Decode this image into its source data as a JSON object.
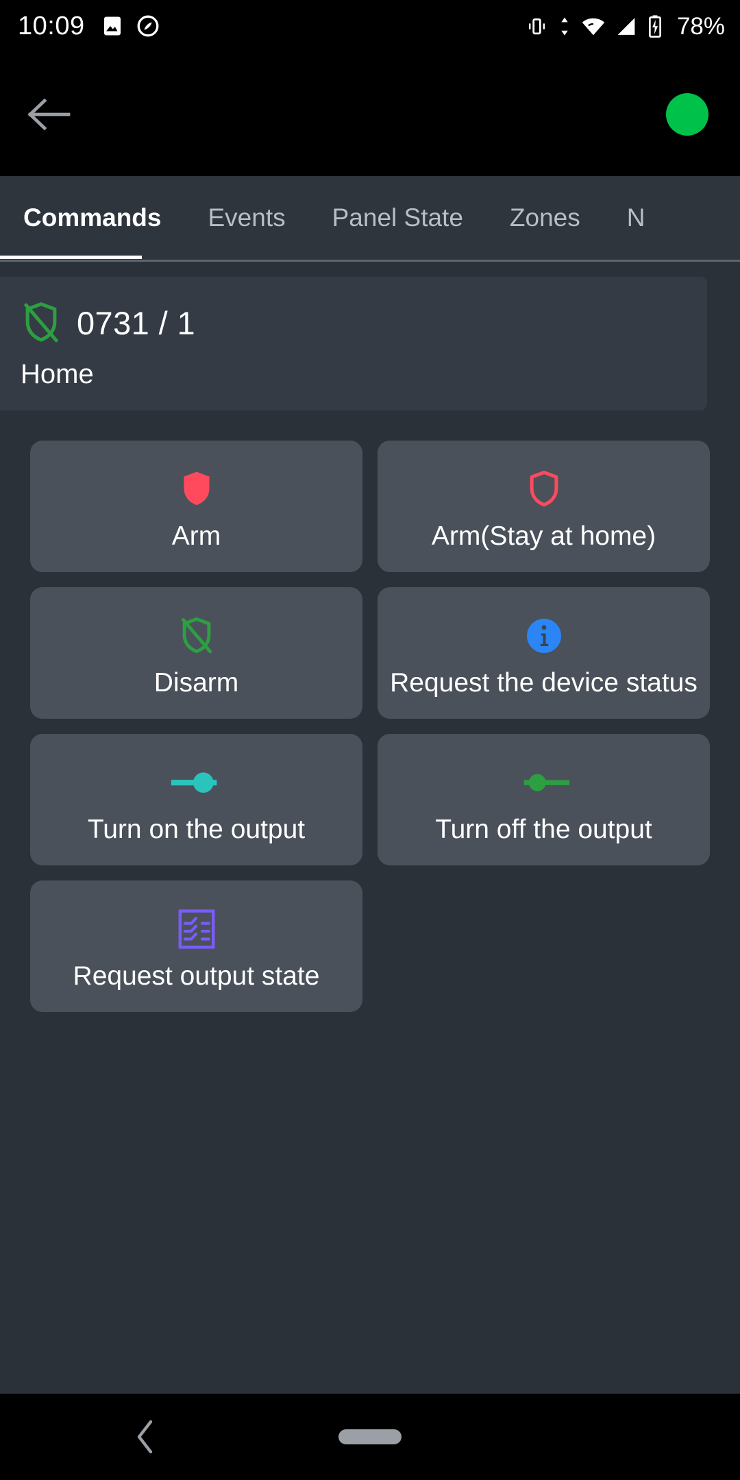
{
  "status_bar": {
    "clock": "10:09",
    "battery_percent": "78%",
    "left_icons": [
      "image-icon",
      "capture-icon"
    ],
    "right_icons": [
      "vibrate-icon",
      "data-transfer-icon",
      "wifi-icon",
      "cellular-signal-icon",
      "battery-charging-icon"
    ]
  },
  "app_bar": {
    "back_icon": "back-arrow-icon",
    "connection_status_color": "#00c24a",
    "connection_status_name": "online-indicator"
  },
  "tabs": {
    "items": [
      {
        "label": "Commands",
        "active": true
      },
      {
        "label": "Events",
        "active": false
      },
      {
        "label": "Panel State",
        "active": false
      },
      {
        "label": "Zones",
        "active": false
      },
      {
        "label": "N",
        "active": false
      }
    ]
  },
  "panel": {
    "icon": "shield-off-icon",
    "icon_color": "#2e9e42",
    "title": "0731 / 1",
    "subtitle": "Home"
  },
  "commands": [
    {
      "label": "Arm",
      "icon": "shield-filled-icon",
      "color": "#ff4a5e"
    },
    {
      "label": "Arm(Stay at home)",
      "icon": "shield-outline-icon",
      "color": "#ff4a5e"
    },
    {
      "label": "Disarm",
      "icon": "shield-off-icon",
      "color": "#2e9e42"
    },
    {
      "label": "Request the device status",
      "icon": "info-circle-icon",
      "color": "#2b85f5"
    },
    {
      "label": "Turn on the output",
      "icon": "toggle-on-icon",
      "color": "#2ac4bd"
    },
    {
      "label": "Turn off the output",
      "icon": "toggle-off-icon",
      "color": "#2e9e42"
    },
    {
      "label": "Request output state",
      "icon": "relay-state-icon",
      "color": "#7b5cfa"
    }
  ],
  "nav_bar": {
    "back_icon": "nav-back-icon",
    "home_pill": "nav-home-pill"
  }
}
